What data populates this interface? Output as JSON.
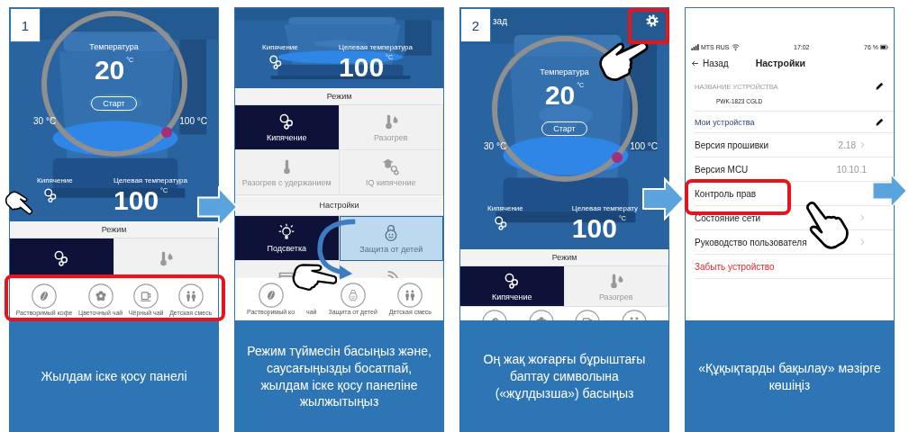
{
  "steps": [
    {
      "kind": "kettle",
      "number": "1",
      "dial": {
        "title": "Температура",
        "value": "20",
        "unit": "°C",
        "start": "Старт",
        "min": "30 °C",
        "max": "100 °C"
      },
      "mode_label": "Кипячение",
      "target_label": "Целевая температура",
      "target_value": "100",
      "target_unit": "°C",
      "mode_header": "Режим",
      "modes": [
        {
          "kind": "boil",
          "selected": true
        },
        {
          "kind": "heat",
          "selected": false
        }
      ],
      "quick_bar": [
        {
          "kind": "coffee",
          "label": "Растворимый кофе"
        },
        {
          "kind": "flower",
          "label": "Цветочный чай"
        },
        {
          "kind": "cup",
          "label": "Чёрный чай"
        },
        {
          "kind": "kids",
          "label": "Детская смесь"
        }
      ],
      "caption": "Жылдам іске қосу панелі"
    },
    {
      "kind": "modes",
      "mode_label": "Кипячение",
      "target_label": "Целевая температура",
      "target_value": "100",
      "target_unit": "°C",
      "mode_header": "Режим",
      "modes": [
        {
          "kind": "boil",
          "label": "Кипячение",
          "selected": true
        },
        {
          "kind": "heat",
          "label": "Разогрев",
          "selected": false
        },
        {
          "kind": "keep-warm",
          "label": "Разогрев с удержанием",
          "selected": false
        },
        {
          "kind": "iq-boil",
          "label": "IQ кипячение",
          "selected": false
        }
      ],
      "settings_header": "Настройки",
      "settings": [
        {
          "kind": "backlight",
          "label": "Подсветка",
          "selected": true,
          "highlighted": false
        },
        {
          "kind": "child-lock",
          "label": "Защита от детей",
          "selected": false,
          "highlighted": true
        },
        {
          "kind": "bed",
          "selected": false,
          "highlighted": false
        },
        {
          "kind": "waves",
          "selected": false,
          "highlighted": false
        }
      ],
      "quick_bar": [
        {
          "kind": "coffee",
          "label": "Растворимый ко"
        },
        {
          "kind": "hidden",
          "label": "чай"
        },
        {
          "kind": "child-lock",
          "label": "Защита от детей"
        },
        {
          "kind": "kids",
          "label": "Детская смесь"
        }
      ],
      "caption": "Режим түймесін басыңыз және, саусағыңызды босатпай, жылдам іске қосу панеліне жылжытыңыз"
    },
    {
      "kind": "kettle",
      "number": "2",
      "back": "зад",
      "settings_button": true,
      "dial": {
        "title": "Температура",
        "value": "20",
        "unit": "°C",
        "start": "Старт",
        "min": "30 °C",
        "max": "100 °C"
      },
      "mode_label": "Кипячение",
      "target_label": "Целевая температу",
      "target_value": "100",
      "target_unit": "°C",
      "mode_header": "Режим",
      "modes": [
        {
          "kind": "boil",
          "label": "Кипячение",
          "selected": true
        },
        {
          "kind": "heat",
          "label": "Разогрев",
          "selected": false
        }
      ],
      "quick_bar": [
        {
          "kind": "coffee"
        },
        {
          "kind": "flower"
        },
        {
          "kind": "cup"
        },
        {
          "kind": "kids"
        }
      ],
      "caption": "Оң жақ жоғарғы бұрыштағы баптау символына («жұлдызша») басыңыз"
    },
    {
      "kind": "settings",
      "status": {
        "carrier": "MTS RUS",
        "time": "17:02",
        "battery": "76 %"
      },
      "back": "Назад",
      "title": "Настройки",
      "section": "НАЗВАНИЕ УСТРОЙСТВА",
      "device": "PWK-1823 CGLD",
      "my_devices": "Мои устройства",
      "rows": [
        {
          "kind": "item",
          "label": "Версия прошивки",
          "value": "2.18",
          "chevron": true
        },
        {
          "kind": "item",
          "label": "Версия MCU",
          "value": "10.10.1",
          "chevron": false
        },
        {
          "kind": "item",
          "label": "Контроль прав",
          "chevron": false
        },
        {
          "kind": "item",
          "label": "Состояние сети",
          "chevron": true
        },
        {
          "kind": "item",
          "label": "Руководство пользователя",
          "chevron": true
        },
        {
          "kind": "danger",
          "label": "Забыть устройство",
          "chevron": false
        }
      ],
      "caption": "«Құқықтарды бақылау» мәзірге көшіңіз"
    }
  ]
}
